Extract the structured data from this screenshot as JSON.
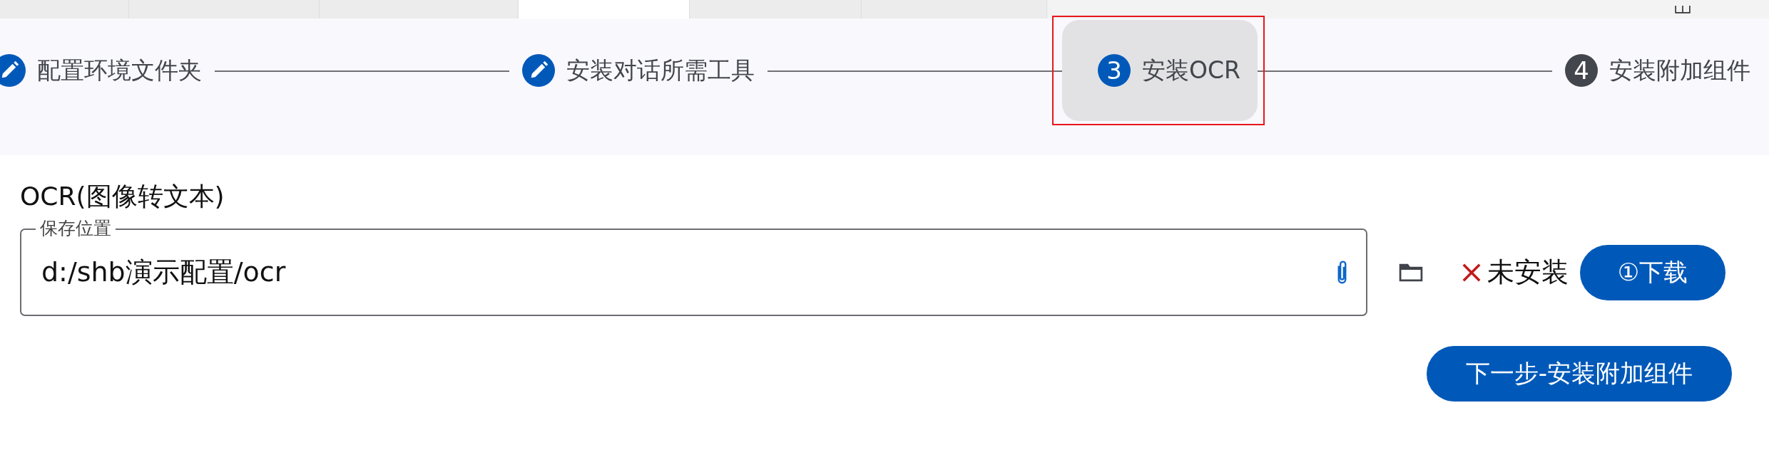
{
  "tabs": [
    {
      "selected": false
    },
    {
      "selected": false
    },
    {
      "selected": false
    },
    {
      "selected": true
    },
    {
      "selected": false
    },
    {
      "selected": false
    }
  ],
  "steps": [
    {
      "label": "配置环境文件夹",
      "kind": "done",
      "selected": false
    },
    {
      "label": "安装对话所需工具",
      "kind": "done",
      "selected": false
    },
    {
      "label": "安装OCR",
      "kind": "current",
      "number": "3",
      "selected": true
    },
    {
      "label": "安装附加组件",
      "kind": "pending",
      "number": "4",
      "selected": false
    }
  ],
  "section": {
    "title": "OCR(图像转文本)",
    "field": {
      "label": "保存位置",
      "value": "d:/shb演示配置/ocr"
    },
    "status": {
      "installed": false,
      "text": "未安装"
    },
    "download_button": "①下载",
    "next_button": "下一步-安装附加组件"
  }
}
